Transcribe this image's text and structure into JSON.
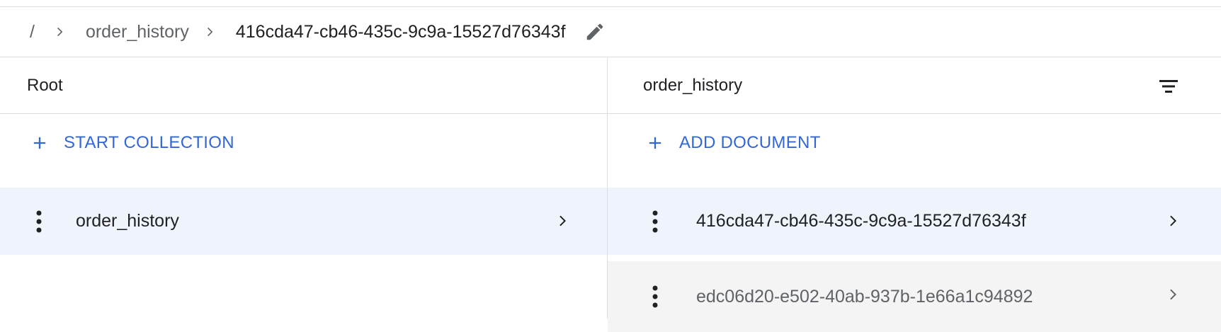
{
  "breadcrumb": {
    "root": "/",
    "collection": "order_history",
    "document": "416cda47-cb46-435c-9c9a-15527d76343f"
  },
  "left_panel": {
    "title": "Root",
    "action_label": "START COLLECTION",
    "items": [
      {
        "label": "order_history",
        "selected": true
      }
    ]
  },
  "right_panel": {
    "title": "order_history",
    "action_label": "ADD DOCUMENT",
    "items": [
      {
        "label": "416cda47-cb46-435c-9c9a-15527d76343f",
        "selected": true
      },
      {
        "label": "edc06d20-e502-40ab-937b-1e66a1c94892",
        "selected": false
      }
    ]
  },
  "colors": {
    "accent": "#3367d6",
    "selected_row": "#eff4fc",
    "hover_row": "#f4f4f4",
    "divider": "#dadce0"
  }
}
